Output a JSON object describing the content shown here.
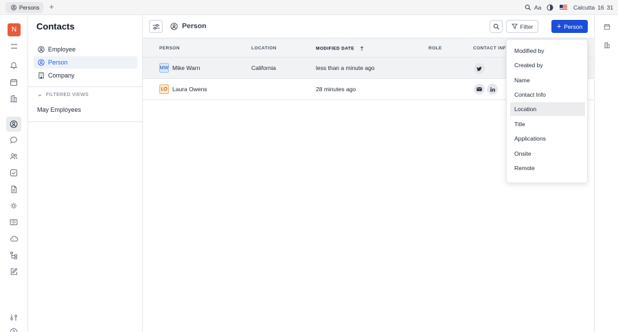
{
  "topbar": {
    "tab_label": "Persons",
    "search_label": "Aa",
    "location": "Calcutta",
    "time_hour": "16",
    "time_min": "31"
  },
  "rail": {
    "logo_letter": "N",
    "brand_color": "#e65b3b"
  },
  "sidebar": {
    "title": "Contacts",
    "items": [
      {
        "label": "Employee"
      },
      {
        "label": "Person"
      },
      {
        "label": "Company"
      }
    ],
    "filtered_views_header": "FILTERED VIEWS",
    "filtered_views": [
      {
        "label": "May Employees"
      }
    ]
  },
  "toolbar": {
    "view_title": "Person",
    "filter_label": "Filter",
    "add_label": "Person",
    "accent": "#1d4ed8"
  },
  "table": {
    "headers": [
      "PERSON",
      "LOCATION",
      "MODIFIED DATE",
      "ROLE",
      "CONTACT INFO"
    ],
    "rows": [
      {
        "initials": "MW",
        "name": "Mike Warn",
        "location": "California",
        "modified": "less than a minute ago",
        "contacts": [
          "twitter"
        ]
      },
      {
        "initials": "LO",
        "name": "Laura Owens",
        "location": "",
        "modified": "28 minutes ago",
        "contacts": [
          "email",
          "linkedin"
        ]
      }
    ]
  },
  "menu": {
    "items": [
      "Modified by",
      "Created by",
      "Name",
      "Contact Info",
      "Location",
      "Title",
      "Applications",
      "Onsite",
      "Remote"
    ],
    "selected": "Location"
  }
}
